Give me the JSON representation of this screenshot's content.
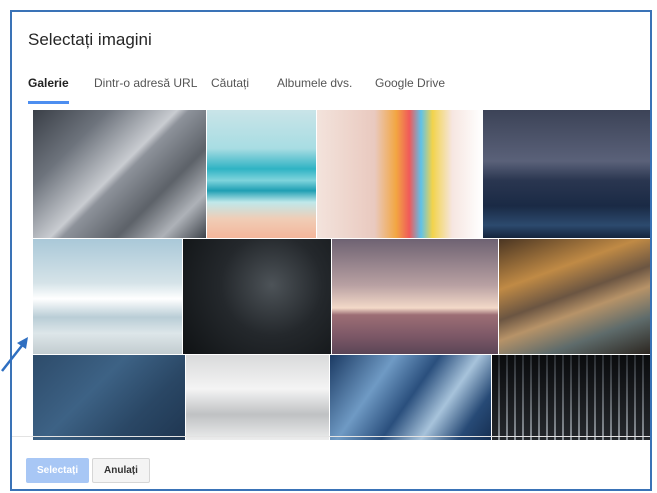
{
  "dialog": {
    "title": "Selectați imagini",
    "accent_color": "#4d8ef0",
    "border_color": "#3a73b7"
  },
  "tabs": [
    {
      "label": "Galerie",
      "active": true
    },
    {
      "label": "Dintr-o adresă URL",
      "active": false
    },
    {
      "label": "Căutați",
      "active": false
    },
    {
      "label": "Albumele dvs.",
      "active": false
    },
    {
      "label": "Google Drive",
      "active": false
    }
  ],
  "footer": {
    "select_label": "Selectați",
    "cancel_label": "Anulați"
  },
  "gallery": {
    "images": [
      {
        "subject": "gray-diagonal-planks"
      },
      {
        "subject": "turquoise-sea-waves"
      },
      {
        "subject": "colorful-sticky-notes"
      },
      {
        "subject": "night-ice-lake"
      },
      {
        "subject": "foamy-beach-shore"
      },
      {
        "subject": "typewriter-keys"
      },
      {
        "subject": "pink-sunset-horizon"
      },
      {
        "subject": "blurred-golden-lights"
      },
      {
        "subject": "blue-textured-surface"
      },
      {
        "subject": "white-fog-mountains"
      },
      {
        "subject": "blue-wave-lines"
      },
      {
        "subject": "audio-mixing-console"
      }
    ]
  },
  "annotation": {
    "color": "#2f6fc1"
  }
}
